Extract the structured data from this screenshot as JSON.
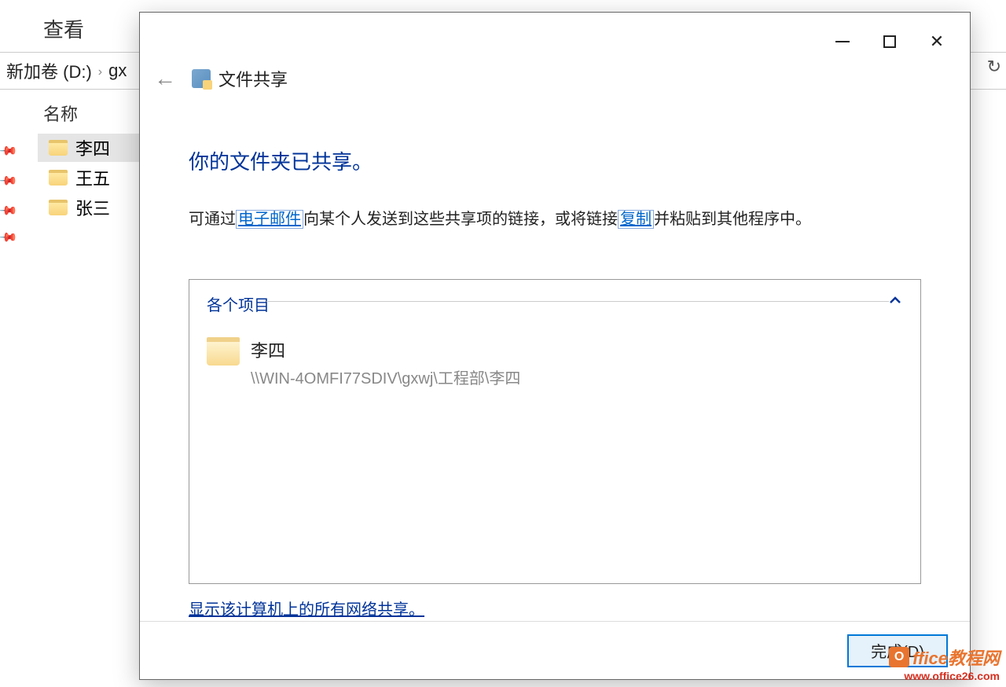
{
  "explorer": {
    "tab_view": "查看",
    "path_drive": "新加卷 (D:)",
    "path_sub": "gx",
    "col_name": "名称",
    "folders": [
      "李四",
      "王五",
      "张三"
    ]
  },
  "dialog": {
    "title": "文件共享",
    "heading": "你的文件夹已共享。",
    "desc_prefix": "可通过",
    "desc_email_link": "电子邮件",
    "desc_mid": "向某个人发送到这些共享项的链接，或将链接",
    "desc_copy_link": "复制",
    "desc_suffix": "并粘贴到其他程序中。",
    "items_header": "各个项目",
    "shared_item": {
      "name": "李四",
      "path": "\\\\WIN-4OMFI77SDIV\\gxwj\\工程部\\李四"
    },
    "show_all_link": "显示该计算机上的所有网络共享。",
    "done_button": "完成(D)"
  },
  "watermark": {
    "brand": "ffice教程网",
    "logo_letter": "O",
    "url": "www.office26.com"
  }
}
